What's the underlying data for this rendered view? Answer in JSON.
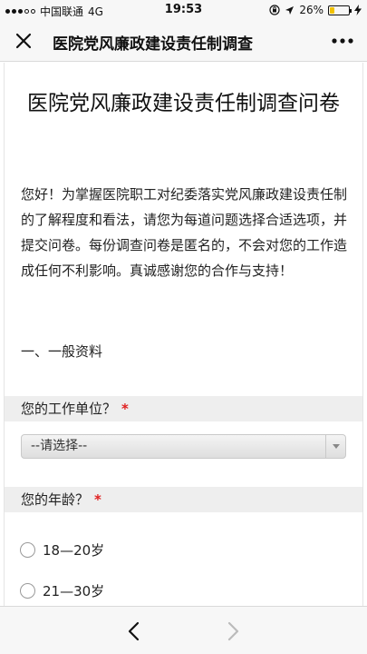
{
  "status_bar": {
    "carrier": "中国联通",
    "network": "4G",
    "time": "19:53",
    "battery": "26%",
    "battery_level": 0.26
  },
  "nav": {
    "title": "医院党风廉政建设责任制调查",
    "close_icon": "close-icon",
    "more_icon": "more-icon"
  },
  "survey": {
    "title": "医院党风廉政建设责任制调查问卷",
    "intro": "您好！为掌握医院职工对纪委落实党风廉政建设责任制的了解程度和看法，请您为每道问题选择合适选项，并提交问卷。每份调查问卷是匿名的，不会对您的工作造成任何不利影响。真诚感谢您的合作与支持！",
    "section": "一、一般资料",
    "required_mark": "*",
    "q1": {
      "label": "您的工作单位？",
      "selected": "--请选择--"
    },
    "q2": {
      "label": "您的年龄？",
      "options": [
        "18—20岁",
        "21—30岁"
      ]
    }
  },
  "bottom_nav": {
    "back_icon": "chevron-left-icon",
    "forward_icon": "chevron-right-icon"
  }
}
